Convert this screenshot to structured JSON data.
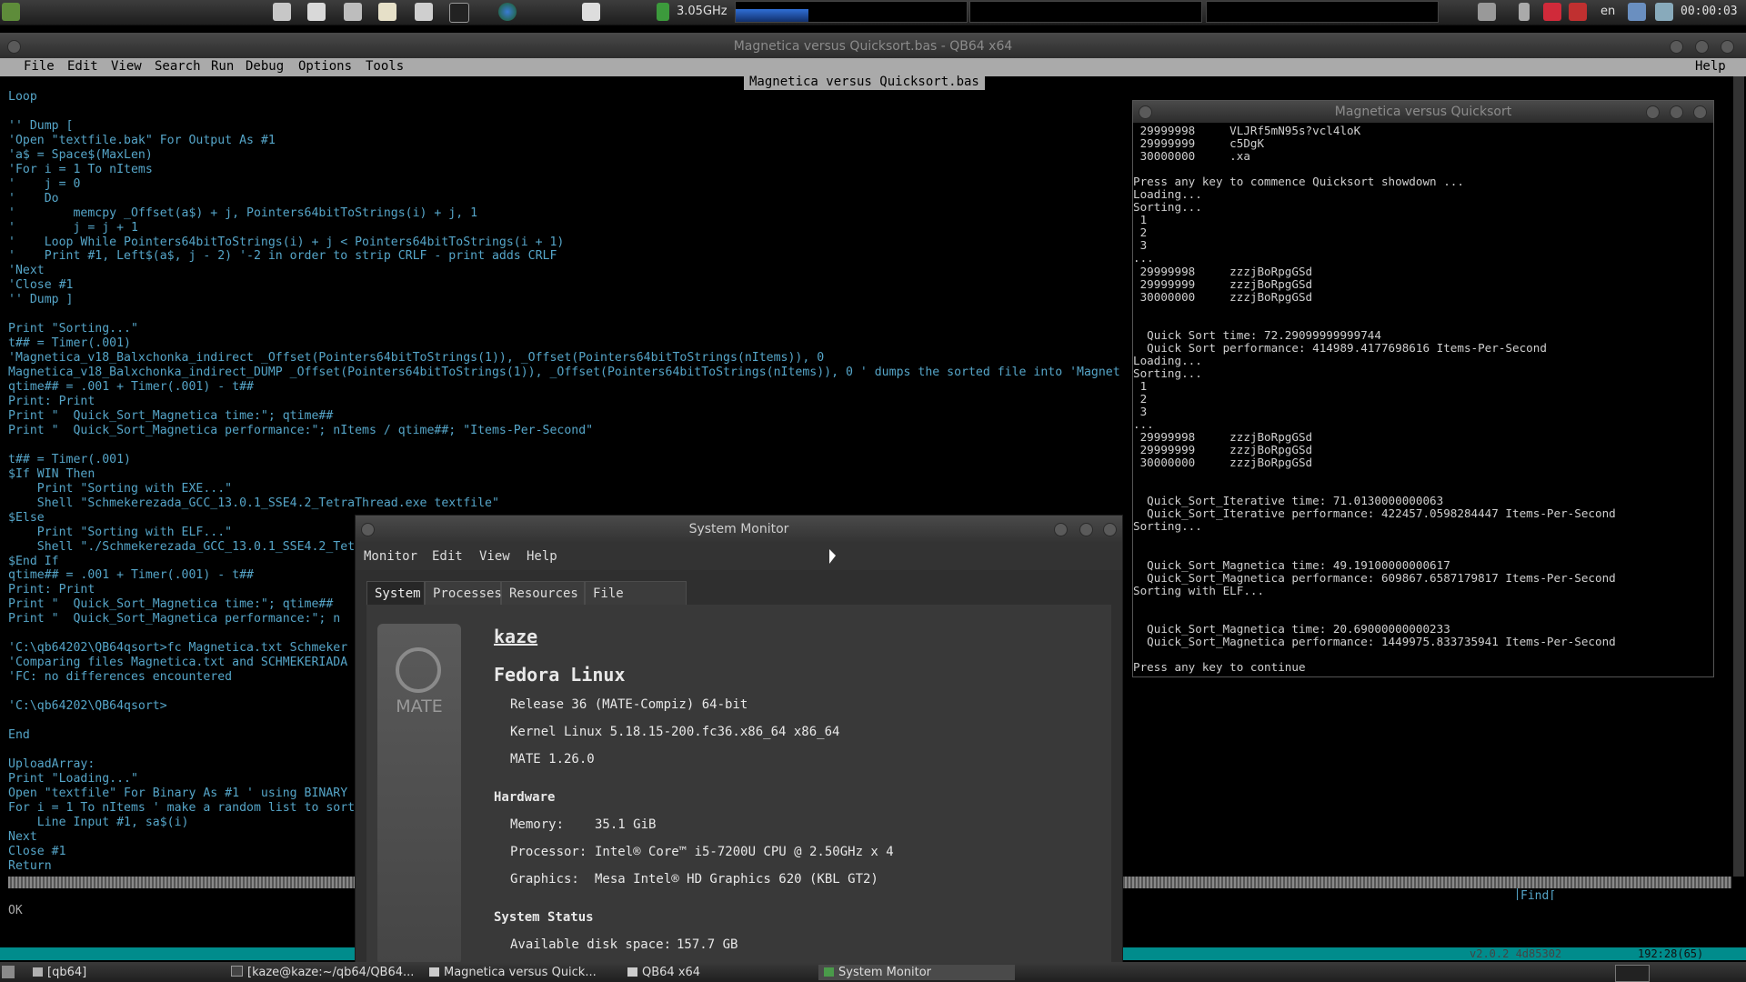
{
  "top_panel": {
    "cpu_freq": "3.05GHz",
    "keyboard_layout": "en",
    "clock": "00:00:03",
    "launchers": [
      "menu-icon",
      "files-icon",
      "search-icon",
      "calculator-icon",
      "text-editor-icon",
      "image-viewer-icon",
      "terminal-icon",
      "browser-icon"
    ],
    "tray": [
      "volume-icon",
      "bluetooth-icon",
      "security-icon",
      "package-icon",
      "network-icon",
      "clipboard-icon"
    ]
  },
  "qb64": {
    "window_title": "Magnetica versus Quicksort.bas - QB64 x64",
    "menu": [
      "File",
      "Edit",
      "View",
      "Search",
      "Run",
      "Debug",
      "Options",
      "Tools"
    ],
    "help_menu": "Help",
    "file_tab": "Magnetica versus Quicksort.bas",
    "code": "Loop\n\n'' Dump [\n'Open \"textfile.bak\" For Output As #1\n'a$ = Space$(MaxLen)\n'For i = 1 To nItems\n'    j = 0\n'    Do\n'        memcpy _Offset(a$) + j, Pointers64bitToStrings(i) + j, 1\n'        j = j + 1\n'    Loop While Pointers64bitToStrings(i) + j < Pointers64bitToStrings(i + 1)\n'    Print #1, Left$(a$, j - 2) '-2 in order to strip CRLF - print adds CRLF\n'Next\n'Close #1\n'' Dump ]\n\nPrint \"Sorting...\"\nt## = Timer(.001)\n'Magnetica_v18_Balxchonka_indirect _Offset(Pointers64bitToStrings(1)), _Offset(Pointers64bitToStrings(nItems)), 0\nMagnetica_v18_Balxchonka_indirect_DUMP _Offset(Pointers64bitToStrings(1)), _Offset(Pointers64bitToStrings(nItems)), 0 ' dumps the sorted file into 'Magnet\nqtime## = .001 + Timer(.001) - t##\nPrint: Print\nPrint \"  Quick_Sort_Magnetica time:\"; qtime##\nPrint \"  Quick_Sort_Magnetica performance:\"; nItems / qtime##; \"Items-Per-Second\"\n\nt## = Timer(.001)\n$If WIN Then\n    Print \"Sorting with EXE...\"\n    Shell \"Schmekerezada_GCC_13.0.1_SSE4.2_TetraThread.exe textfile\"\n$Else\n    Print \"Sorting with ELF...\"\n    Shell \"./Schmekerezada_GCC_13.0.1_SSE4.2_Tet\n$End If\nqtime## = .001 + Timer(.001) - t##\nPrint: Print\nPrint \"  Quick_Sort_Magnetica time:\"; qtime##\nPrint \"  Quick_Sort_Magnetica performance:\"; n\n\n'C:\\qb64202\\QB64qsort>fc Magnetica.txt Schmeker\n'Comparing files Magnetica.txt and SCHMEKERIADA\n'FC: no differences encountered\n\n'C:\\qb64202\\QB64qsort>\n\nEnd\n\nUploadArray:\nPrint \"Loading...\"\nOpen \"textfile\" For Binary As #1 ' using BINARY\nFor i = 1 To nItems ' make a random list to sort\n    Line Input #1, sa$(i)\nNext\nClose #1\nReturn",
    "status_ok": "OK",
    "find_label": "Find[",
    "version": "v2.0.2 4d85302",
    "cursor_pos": "192:28(65)"
  },
  "output_window": {
    "title": "Magnetica versus Quicksort",
    "text": " 29999998     VLJRf5mN95s?vcl4loK\n 29999999     c5DgK\n 30000000     .xa\n\nPress any key to commence Quicksort showdown ...\nLoading...\nSorting...\n 1\n 2\n 3\n...\n 29999998     zzzjBoRpgGSd\n 29999999     zzzjBoRpgGSd\n 30000000     zzzjBoRpgGSd\n\n\n  Quick Sort time: 72.29099999999744\n  Quick Sort performance: 414989.4177698616 Items-Per-Second\nLoading...\nSorting...\n 1\n 2\n 3\n...\n 29999998     zzzjBoRpgGSd\n 29999999     zzzjBoRpgGSd\n 30000000     zzzjBoRpgGSd\n\n\n  Quick_Sort_Iterative time: 71.0130000000063\n  Quick_Sort_Iterative performance: 422457.0598284447 Items-Per-Second\nSorting...\n\n\n  Quick_Sort_Magnetica time: 49.19100000000617\n  Quick_Sort_Magnetica performance: 609867.6587179817 Items-Per-Second\nSorting with ELF...\n\n\n  Quick_Sort_Magnetica time: 20.69000000000233\n  Quick_Sort_Magnetica performance: 1449975.833735941 Items-Per-Second\n\nPress any key to continue"
  },
  "system_monitor": {
    "title": "System Monitor",
    "menu": [
      "Monitor",
      "Edit",
      "View",
      "Help"
    ],
    "tabs": [
      "System",
      "Processes",
      "Resources",
      "File Systems"
    ],
    "logo_text": "MATE",
    "hostname": "kaze",
    "os_name": "Fedora Linux",
    "release": "Release 36 (MATE-Compiz) 64-bit",
    "kernel": "Kernel Linux 5.18.15-200.fc36.x86_64 x86_64",
    "desktop": "MATE 1.26.0",
    "hardware_heading": "Hardware",
    "memory_label": "Memory:",
    "memory_value": "35.1 GiB",
    "processor_label": "Processor:",
    "processor_value": "Intel® Core™ i5-7200U CPU @ 2.50GHz x 4",
    "graphics_label": "Graphics:",
    "graphics_value": "Mesa Intel® HD Graphics 620 (KBL GT2)",
    "status_heading": "System Status",
    "disk_label": "Available disk space:",
    "disk_value": "157.7 GB"
  },
  "taskbar": {
    "items": [
      "[qb64]",
      "[kaze@kaze:~/qb64/QB64...",
      "Magnetica versus Quick...",
      "QB64 x64",
      "System Monitor"
    ]
  }
}
